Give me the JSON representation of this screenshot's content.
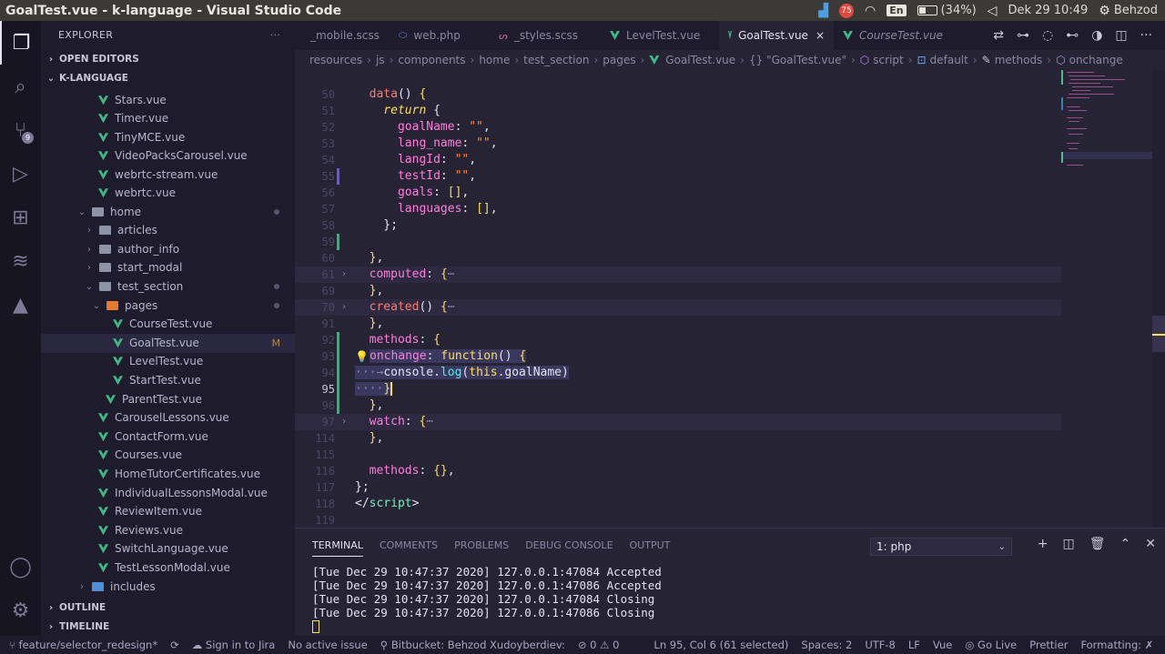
{
  "window": {
    "title": "GoalTest.vue - k-language - Visual Studio Code"
  },
  "tray": {
    "keyboard": "En",
    "battery": "(34%)",
    "datetime": "Dek 29 10:49",
    "user": "Behzod",
    "badge": "75"
  },
  "activity": {
    "scm_badge": "9"
  },
  "sidebar": {
    "title": "EXPLORER",
    "more": "···",
    "open_editors": "OPEN EDITORS",
    "project": "K-LANGUAGE",
    "outline": "OUTLINE",
    "timeline": "TIMELINE",
    "tree": [
      {
        "label": "Stars.vue"
      },
      {
        "label": "Timer.vue"
      },
      {
        "label": "TinyMCE.vue"
      },
      {
        "label": "VideoPacksCarousel.vue"
      },
      {
        "label": "webrtc-stream.vue"
      },
      {
        "label": "webrtc.vue"
      },
      {
        "label": "home"
      },
      {
        "label": "articles"
      },
      {
        "label": "author_info"
      },
      {
        "label": "start_modal"
      },
      {
        "label": "test_section"
      },
      {
        "label": "pages"
      },
      {
        "label": "CourseTest.vue"
      },
      {
        "label": "GoalTest.vue",
        "badge": "M"
      },
      {
        "label": "LevelTest.vue"
      },
      {
        "label": "StartTest.vue"
      },
      {
        "label": "ParentTest.vue"
      },
      {
        "label": "CarouselLessons.vue"
      },
      {
        "label": "ContactForm.vue"
      },
      {
        "label": "Courses.vue"
      },
      {
        "label": "HomeTutorCertificates.vue"
      },
      {
        "label": "IndividualLessonsModal.vue"
      },
      {
        "label": "ReviewItem.vue"
      },
      {
        "label": "Reviews.vue"
      },
      {
        "label": "SwitchLanguage.vue"
      },
      {
        "label": "TestLessonModal.vue"
      },
      {
        "label": "includes"
      }
    ]
  },
  "tabs": [
    {
      "label": "_mobile.scss"
    },
    {
      "label": "web.php"
    },
    {
      "label": "_styles.scss"
    },
    {
      "label": "LevelTest.vue"
    },
    {
      "label": "GoalTest.vue",
      "close": "×"
    },
    {
      "label": "CourseTest.vue"
    }
  ],
  "breadcrumb": [
    "resources",
    "js",
    "components",
    "home",
    "test_section",
    "pages",
    "GoalTest.vue",
    "{} \"GoalTest.vue\"",
    "script",
    "default",
    "methods",
    "onchange"
  ],
  "editor": {
    "lines": [
      {
        "n": "50"
      },
      {
        "n": "51"
      },
      {
        "n": "52"
      },
      {
        "n": "53"
      },
      {
        "n": "54"
      },
      {
        "n": "55"
      },
      {
        "n": "56"
      },
      {
        "n": "57"
      },
      {
        "n": "58"
      },
      {
        "n": "59"
      },
      {
        "n": "60"
      },
      {
        "n": "61"
      },
      {
        "n": "69"
      },
      {
        "n": "70"
      },
      {
        "n": "91"
      },
      {
        "n": "92"
      },
      {
        "n": "93"
      },
      {
        "n": "94"
      },
      {
        "n": "95"
      },
      {
        "n": "96"
      },
      {
        "n": "97"
      },
      {
        "n": "114"
      },
      {
        "n": "115"
      },
      {
        "n": "116"
      },
      {
        "n": "117"
      },
      {
        "n": "118"
      },
      {
        "n": "119"
      }
    ]
  },
  "panel": {
    "tabs": [
      "TERMINAL",
      "COMMENTS",
      "PROBLEMS",
      "DEBUG CONSOLE",
      "OUTPUT"
    ],
    "terminal_select": "1: php",
    "lines": [
      "[Tue Dec 29 10:47:37 2020] 127.0.0.1:47084 Accepted",
      "[Tue Dec 29 10:47:37 2020] 127.0.0.1:47086 Accepted",
      "[Tue Dec 29 10:47:37 2020] 127.0.0.1:47084 Closing",
      "[Tue Dec 29 10:47:37 2020] 127.0.0.1:47086 Closing"
    ]
  },
  "status": {
    "branch": "feature/selector_redesign*",
    "jira": "Sign in to Jira",
    "issue": "No active issue",
    "bitbucket": "Bitbucket: Behzod Xudoyberdiev:",
    "problems": "⊘ 0 ⚠ 0",
    "position": "Ln 95, Col 6 (61 selected)",
    "spaces": "Spaces: 2",
    "encoding": "UTF-8",
    "eol": "LF",
    "language": "Vue",
    "golive": "Go Live",
    "prettier": "Prettier",
    "formatting": "Formatting: ✗"
  },
  "colors": {
    "vue": "#41b883",
    "accent": "#ff7edb",
    "keyword": "#fede5d",
    "string": "#ff8b39"
  }
}
